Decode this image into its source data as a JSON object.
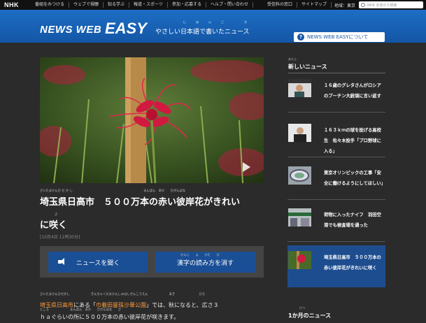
{
  "topbar": {
    "logo": "NHK",
    "nav": [
      "番組をみつける",
      "ウェブで視聴",
      "知る学ぶ",
      "報道・スポーツ",
      "参加・応募する",
      "ヘルプ・問い合わせ",
      "受信料の窓口",
      "サイトマップ"
    ],
    "region": "地域：東京",
    "search_placeholder": "NHK  全体から検索"
  },
  "header": {
    "logo_news": "NEWS WEB",
    "logo_easy": "EASY",
    "tagline": "やさしい日本語で書いたニュース",
    "tagline_ruby": "にほんご か",
    "about_label": "NEWS WEB EASYについて"
  },
  "article": {
    "title_ruby_1": "さいたまけんひ だ か し",
    "title_ruby_2": "まんぼん　あか　　ひがんばな",
    "title_line1": "埼玉県日高市　５００万本の赤い彼岸花がきれい",
    "title_ruby_3": "さ",
    "title_line2": "に咲く",
    "date": "[10月4日 11時30分]",
    "listen_label": "ニュースを聞く",
    "kanji_ruby": "かんじ　　よ　　かた　　け",
    "kanji_label": "漢字の読み方を消す",
    "body_ruby_1": "さいたまけんひだかし　　　　　　　きんちゃくだまけんしゅはしぜんこうえん　　　　　　　あき　　　　　　　　ひろ",
    "body_pre": "",
    "body_place": "埼玉県日高市",
    "body_mid": "にある「",
    "body_org": "巾着田曼珠沙華公園",
    "body_post": "」では、秋になると、広さ３",
    "body_ruby_2": "ところ　　　　　　　まんぼん　あか　　ひがんばな　　さ",
    "body_line2": "ｈａぐらいの所に５００万本の赤い彼岸花が咲きます。"
  },
  "sidebar": {
    "heading_ruby": "あたら",
    "heading": "新しいニュース",
    "items": [
      {
        "text": "１６歳のグレタさんがロシアのプーチン大統領に言い返す"
      },
      {
        "text": "１６３ｋｍの球を投げる高校生　佐々木投手「プロ野球に入る」"
      },
      {
        "text": "東京オリンピックの工事「安全に働けるようにしてほしい」"
      },
      {
        "text": "荷物に入ったナイフ　羽田空港でも検査場を通った"
      },
      {
        "text": "埼玉県日高市　５００万本の赤い彼岸花がきれいに咲く"
      }
    ],
    "month_ruby": "げつ",
    "month_heading": "1か月のニュース"
  },
  "colors": {
    "header_blue": "#1456a6",
    "background": "#2b2b2b",
    "place_orange": "#ff9a3a",
    "active_item": "#1d4d8f"
  }
}
